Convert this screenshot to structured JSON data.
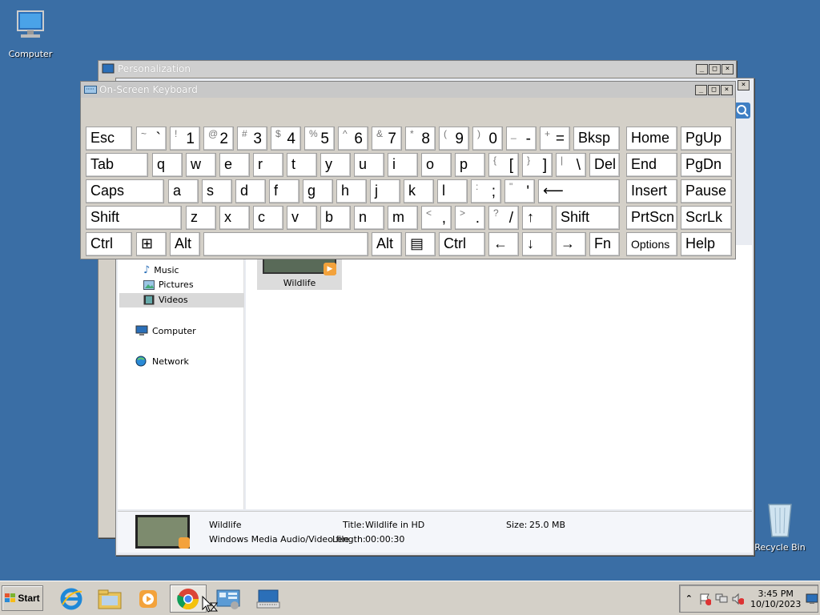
{
  "desktop": {
    "icons": [
      {
        "label": "Computer"
      },
      {
        "label": "Recycle Bin"
      }
    ]
  },
  "personalization": {
    "title": "Personalization"
  },
  "explorer": {
    "nav": [
      {
        "label": "Music"
      },
      {
        "label": "Pictures"
      },
      {
        "label": "Videos"
      },
      {
        "label": "Computer"
      },
      {
        "label": "Network"
      }
    ],
    "files": [
      {
        "label": "Wildlife"
      }
    ],
    "details": {
      "name": "Wildlife",
      "type": "Windows Media Audio/Video file",
      "title_label": "Title:",
      "title_value": "Wildlife in HD",
      "length_label": "Length:",
      "length_value": "00:00:30",
      "size_label": "Size:",
      "size_value": "25.0 MB"
    }
  },
  "osk": {
    "title": "On-Screen Keyboard",
    "rows": [
      [
        {
          "main": "Esc"
        },
        {
          "small": "~",
          "big": "`"
        },
        {
          "small": "!",
          "big": "1"
        },
        {
          "small": "@",
          "big": "2"
        },
        {
          "small": "#",
          "big": "3"
        },
        {
          "small": "$",
          "big": "4"
        },
        {
          "small": "%",
          "big": "5"
        },
        {
          "small": "^",
          "big": "6"
        },
        {
          "small": "&",
          "big": "7"
        },
        {
          "small": "*",
          "big": "8"
        },
        {
          "small": "(",
          "big": "9"
        },
        {
          "small": ")",
          "big": "0"
        },
        {
          "small": "_",
          "big": "-"
        },
        {
          "small": "+",
          "big": "="
        },
        {
          "main": "Bksp"
        },
        {
          "main": "Home"
        },
        {
          "main": "PgUp"
        }
      ],
      [
        {
          "main": "Tab"
        },
        {
          "main": "q"
        },
        {
          "main": "w"
        },
        {
          "main": "e"
        },
        {
          "main": "r"
        },
        {
          "main": "t"
        },
        {
          "main": "y"
        },
        {
          "main": "u"
        },
        {
          "main": "i"
        },
        {
          "main": "o"
        },
        {
          "main": "p"
        },
        {
          "small": "{",
          "big": "["
        },
        {
          "small": "}",
          "big": "]"
        },
        {
          "small": "|",
          "big": "\\"
        },
        {
          "main": "Del"
        },
        {
          "main": "End"
        },
        {
          "main": "PgDn"
        }
      ],
      [
        {
          "main": "Caps"
        },
        {
          "main": "a"
        },
        {
          "main": "s"
        },
        {
          "main": "d"
        },
        {
          "main": "f"
        },
        {
          "main": "g"
        },
        {
          "main": "h"
        },
        {
          "main": "j"
        },
        {
          "main": "k"
        },
        {
          "main": "l"
        },
        {
          "small": ":",
          "big": ";"
        },
        {
          "small": "\"",
          "big": "'"
        },
        {
          "main": "⟵"
        },
        {
          "main": "Insert"
        },
        {
          "main": "Pause"
        }
      ],
      [
        {
          "main": "Shift"
        },
        {
          "main": "z"
        },
        {
          "main": "x"
        },
        {
          "main": "c"
        },
        {
          "main": "v"
        },
        {
          "main": "b"
        },
        {
          "main": "n"
        },
        {
          "main": "m"
        },
        {
          "small": "<",
          "big": ","
        },
        {
          "small": ">",
          "big": "."
        },
        {
          "small": "?",
          "big": "/"
        },
        {
          "main": "↑"
        },
        {
          "main": "Shift"
        },
        {
          "main": "PrtScn"
        },
        {
          "main": "ScrLk"
        }
      ],
      [
        {
          "main": "Ctrl"
        },
        {
          "main": "⊞"
        },
        {
          "main": "Alt"
        },
        {
          "main": ""
        },
        {
          "main": "Alt"
        },
        {
          "main": "▤"
        },
        {
          "main": "Ctrl"
        },
        {
          "main": "←"
        },
        {
          "main": "↓"
        },
        {
          "main": "→"
        },
        {
          "main": "Fn"
        },
        {
          "main": "Options"
        },
        {
          "main": "Help"
        }
      ]
    ]
  },
  "taskbar": {
    "start_label": "Start",
    "clock_time": "3:45 PM",
    "clock_date": "10/10/2023"
  }
}
